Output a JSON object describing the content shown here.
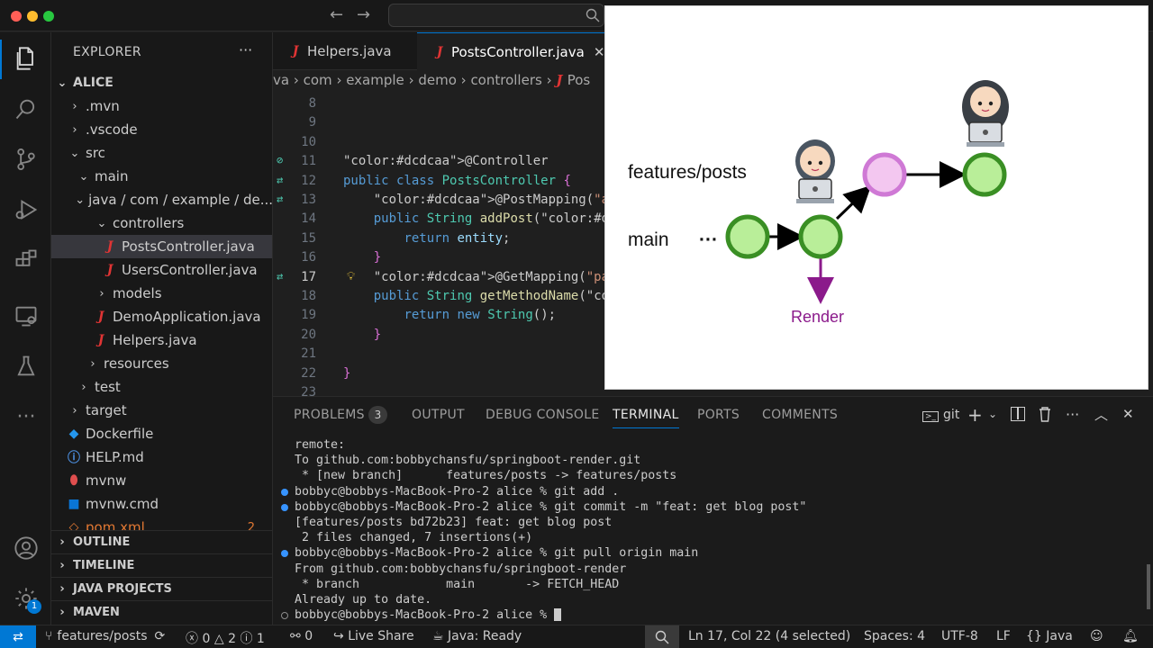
{
  "titlebar": {
    "search_placeholder": ""
  },
  "explorer": {
    "title": "EXPLORER",
    "more": "···",
    "root": "ALICE",
    "tree": [
      {
        "label": ".mvn",
        "depth": 1,
        "chev": "›"
      },
      {
        "label": ".vscode",
        "depth": 1,
        "chev": "›"
      },
      {
        "label": "src",
        "depth": 1,
        "chev": "⌄"
      },
      {
        "label": "main",
        "depth": 2,
        "chev": "⌄"
      },
      {
        "label": "java / com / example / de...",
        "depth": 3,
        "chev": "⌄"
      },
      {
        "label": "controllers",
        "depth": 4,
        "chev": "⌄"
      },
      {
        "label": "PostsController.java",
        "depth": 5,
        "icon": "J",
        "selected": true
      },
      {
        "label": "UsersController.java",
        "depth": 5,
        "icon": "J"
      },
      {
        "label": "models",
        "depth": 4,
        "chev": "›"
      },
      {
        "label": "DemoApplication.java",
        "depth": 4,
        "icon": "J"
      },
      {
        "label": "Helpers.java",
        "depth": 4,
        "icon": "J"
      },
      {
        "label": "resources",
        "depth": 3,
        "chev": "›"
      },
      {
        "label": "test",
        "depth": 2,
        "chev": "›"
      },
      {
        "label": "target",
        "depth": 1,
        "chev": "›"
      },
      {
        "label": "Dockerfile",
        "depth": 1,
        "icon": "docker"
      },
      {
        "label": "HELP.md",
        "depth": 1,
        "icon": "md"
      },
      {
        "label": "mvnw",
        "depth": 1,
        "icon": "mvn"
      },
      {
        "label": "mvnw.cmd",
        "depth": 1,
        "icon": "win"
      },
      {
        "label": "pom.xml",
        "depth": 1,
        "icon": "xml",
        "badge": "2"
      }
    ],
    "sections": [
      "OUTLINE",
      "TIMELINE",
      "JAVA PROJECTS",
      "MAVEN"
    ]
  },
  "tabs": [
    {
      "label": "Helpers.java",
      "active": false
    },
    {
      "label": "PostsController.java",
      "active": true
    }
  ],
  "breadcrumb": [
    "va",
    "com",
    "example",
    "demo",
    "controllers",
    "Pos"
  ],
  "code": {
    "line_numbers": [
      "8",
      "9",
      "10",
      "11",
      "12",
      "13",
      "14",
      "15",
      "16",
      "17",
      "18",
      "19",
      "20",
      "21",
      "22",
      "23"
    ],
    "lines": [
      "",
      "",
      "",
      "@Controller",
      "public class PostsController {",
      "    @PostMapping(\"addPost\")",
      "    public String addPost(@Request",
      "        return entity;",
      "    }",
      "    @GetMapping(\"path\")",
      "    public String getMethodName(@R",
      "        return new String();",
      "    }",
      "",
      "}",
      ""
    ]
  },
  "panel": {
    "tabs": [
      "PROBLEMS",
      "OUTPUT",
      "DEBUG CONSOLE",
      "TERMINAL",
      "PORTS",
      "COMMENTS"
    ],
    "problems_count": "3",
    "active_tab": "TERMINAL",
    "shell_label": "git",
    "terminal_lines": [
      {
        "text": "remote:",
        "bullet": ""
      },
      {
        "text": "To github.com:bobbychansfu/springboot-render.git",
        "bullet": ""
      },
      {
        "text": " * [new branch]      features/posts -> features/posts",
        "bullet": ""
      },
      {
        "text": "bobbyc@bobbys-MacBook-Pro-2 alice % git add .",
        "bullet": "blue"
      },
      {
        "text": "bobbyc@bobbys-MacBook-Pro-2 alice % git commit -m \"feat: get blog post\"",
        "bullet": "blue"
      },
      {
        "text": "[features/posts bd72b23] feat: get blog post",
        "bullet": ""
      },
      {
        "text": " 2 files changed, 7 insertions(+)",
        "bullet": ""
      },
      {
        "text": "bobbyc@bobbys-MacBook-Pro-2 alice % git pull origin main",
        "bullet": "blue"
      },
      {
        "text": "From github.com:bobbychansfu/springboot-render",
        "bullet": ""
      },
      {
        "text": " * branch            main       -> FETCH_HEAD",
        "bullet": ""
      },
      {
        "text": "Already up to date.",
        "bullet": ""
      },
      {
        "text": "bobbyc@bobbys-MacBook-Pro-2 alice % ",
        "bullet": "gray"
      }
    ]
  },
  "statusbar": {
    "branch": "features/posts",
    "errors": "0",
    "warnings": "2",
    "info": "1",
    "ports": "0",
    "live_share": "Live Share",
    "java_status": "Java: Ready",
    "cursor": "Ln 17, Col 22 (4 selected)",
    "spaces": "Spaces: 4",
    "encoding": "UTF-8",
    "eol": "LF",
    "language": "Java"
  },
  "diagram": {
    "branch_label": "features/posts",
    "main_label": "main",
    "ellipsis": "···",
    "render_label": "Render",
    "colors": {
      "green_fill": "#b9ee99",
      "green_stroke": "#3a8f24",
      "pink_fill": "#f3c7f0",
      "pink_stroke": "#cf79d5",
      "purple": "#8b1a8b"
    }
  }
}
